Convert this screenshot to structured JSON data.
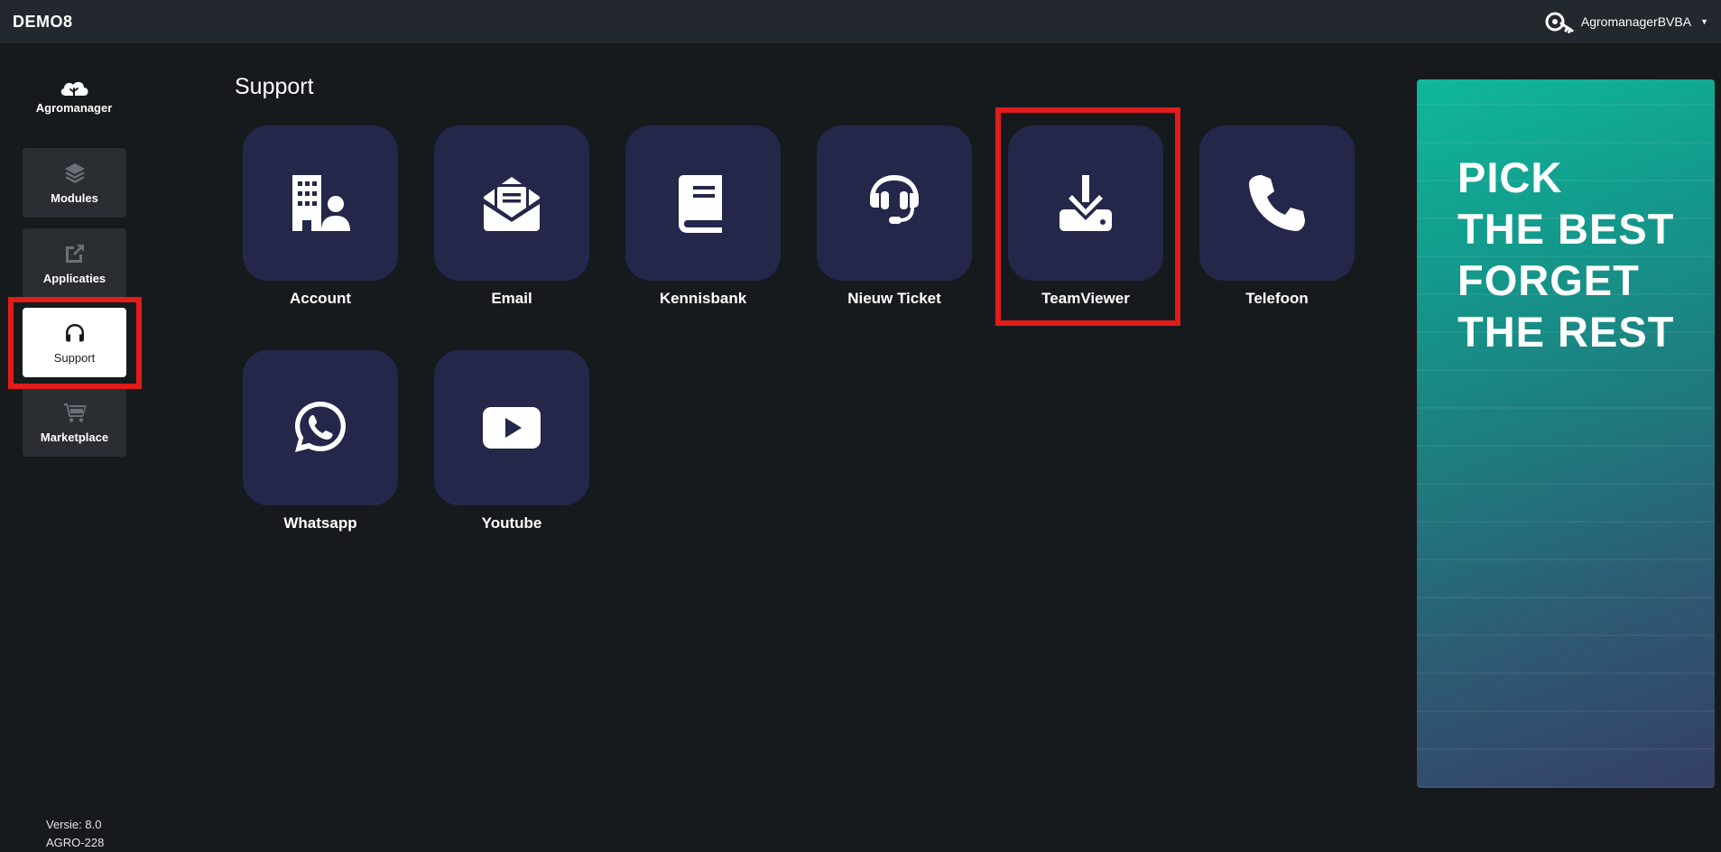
{
  "header": {
    "app_title": "DEMO8",
    "user_name": "AgromanagerBVBA",
    "user_icon": "key-icon",
    "caret_icon": "chevron-down-icon"
  },
  "sidebar": {
    "brand_name": "Agromanager",
    "brand_icon": "cloud-tree-icon",
    "items": [
      {
        "label": "Modules",
        "icon": "layers-icon"
      },
      {
        "label": "Applicaties",
        "icon": "external-link-icon"
      },
      {
        "label": "Support",
        "icon": "headphones-icon",
        "active": true
      },
      {
        "label": "Marketplace",
        "icon": "cart-icon"
      }
    ],
    "version_line": "Versie: 8.0",
    "build_line": "AGRO-228"
  },
  "main": {
    "title": "Support",
    "tiles": [
      {
        "label": "Account",
        "icon": "building-user-icon"
      },
      {
        "label": "Email",
        "icon": "envelope-open-icon"
      },
      {
        "label": "Kennisbank",
        "icon": "book-icon"
      },
      {
        "label": "Nieuw Ticket",
        "icon": "headset-icon"
      },
      {
        "label": "TeamViewer",
        "icon": "download-icon"
      },
      {
        "label": "Telefoon",
        "icon": "phone-icon"
      },
      {
        "label": "Whatsapp",
        "icon": "whatsapp-icon"
      },
      {
        "label": "Youtube",
        "icon": "youtube-icon"
      }
    ]
  },
  "banner": {
    "line1": "PICK",
    "line2": "THE BEST",
    "line3": "FORGET",
    "line4": "THE REST"
  },
  "colors": {
    "background": "#171a1d",
    "topbar": "#23282e",
    "tile": "#24264a",
    "highlight": "#e21b1b",
    "nav_item": "#2a2e33"
  }
}
